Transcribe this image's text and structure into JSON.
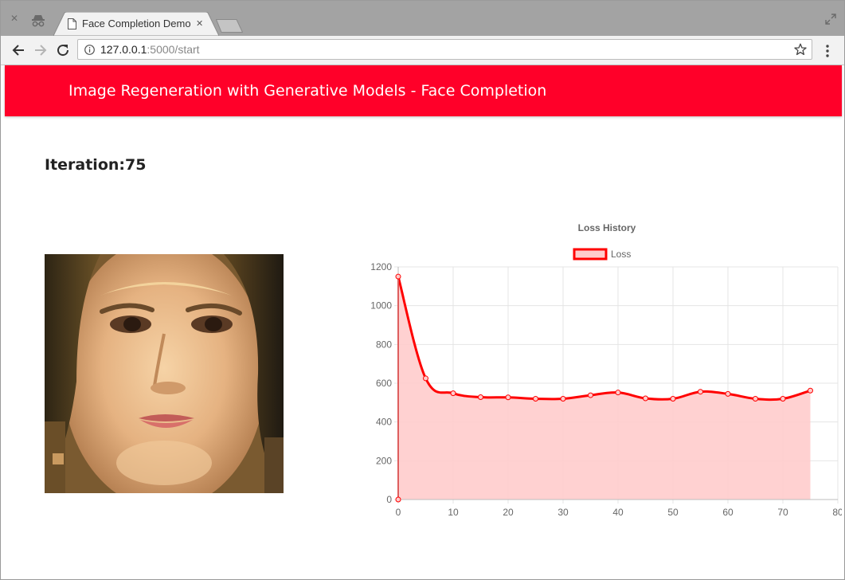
{
  "browser": {
    "tab_title": "Face Completion Demo",
    "url_host": "127.0.0.1",
    "url_path": ":5000/start"
  },
  "app": {
    "header_title": "Image Regeneration with Generative Models - Face Completion",
    "iteration_label": "Iteration:",
    "iteration_value": "75",
    "image_description": "face-reconstruction"
  },
  "colors": {
    "header": "#ff0029",
    "loss_line": "#ff0000",
    "loss_fill": "#ffcccc"
  },
  "icons": [
    "close-icon",
    "incognito-icon",
    "page-icon",
    "back-icon",
    "forward-icon",
    "reload-icon",
    "info-icon",
    "star-icon",
    "menu-icon",
    "restore-icon"
  ],
  "chart_data": {
    "type": "line",
    "title": "Loss History",
    "legend": "top",
    "grid": true,
    "xlim": [
      0,
      80
    ],
    "ylim": [
      0,
      1200
    ],
    "x_ticks": [
      "0",
      "10",
      "20",
      "30",
      "40",
      "50",
      "60",
      "70",
      "80"
    ],
    "y_ticks": [
      "0",
      "200",
      "400",
      "600",
      "800",
      "1000",
      "1200"
    ],
    "series": [
      {
        "name": "Loss",
        "x": [
          0,
          5,
          10,
          15,
          20,
          25,
          30,
          35,
          40,
          45,
          50,
          55,
          60,
          65,
          70,
          75
        ],
        "values": [
          1150,
          625,
          548,
          528,
          527,
          520,
          520,
          538,
          552,
          522,
          520,
          556,
          545,
          520,
          520,
          562
        ]
      }
    ],
    "extra_points": [
      {
        "x": 0,
        "y": 0
      }
    ]
  }
}
